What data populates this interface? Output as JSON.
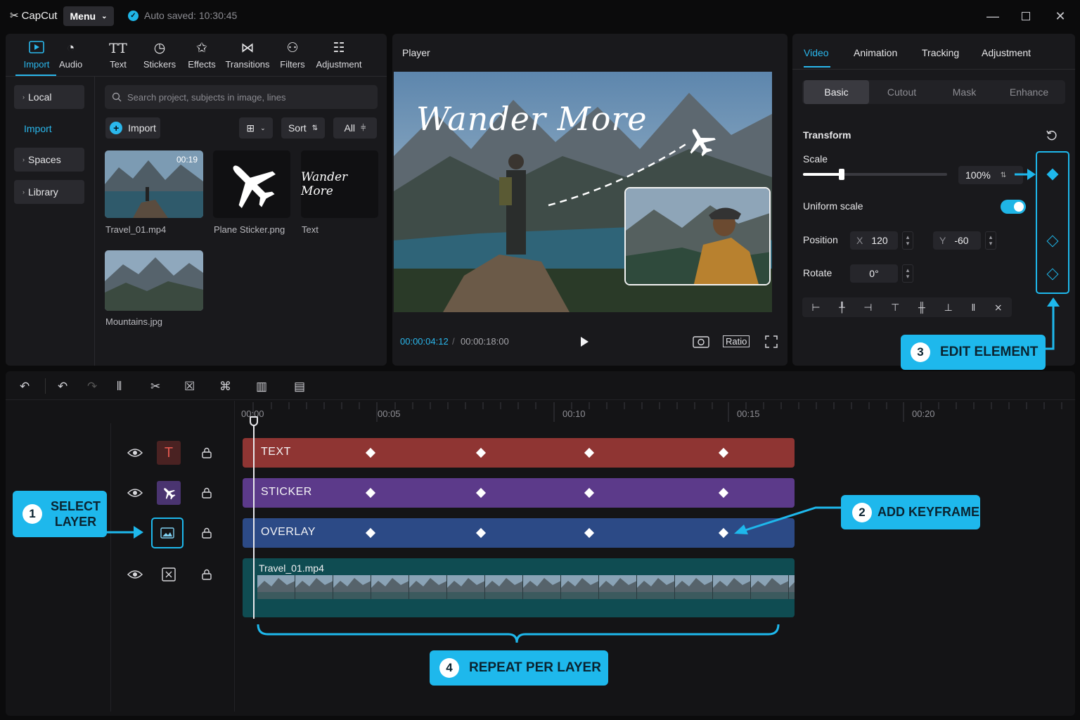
{
  "app": {
    "name": "CapCut",
    "menu_label": "Menu",
    "autosave": "Auto saved: 10:30:45"
  },
  "media": {
    "tools": [
      {
        "label": "Import",
        "icon": "import-icon",
        "active": true
      },
      {
        "label": "Audio",
        "icon": "audio-icon"
      },
      {
        "label": "Text",
        "icon": "text-icon"
      },
      {
        "label": "Stickers",
        "icon": "stickers-icon"
      },
      {
        "label": "Effects",
        "icon": "effects-icon"
      },
      {
        "label": "Transitions",
        "icon": "transitions-icon"
      },
      {
        "label": "Filters",
        "icon": "filters-icon"
      },
      {
        "label": "Adjustment",
        "icon": "adjustment-icon"
      }
    ],
    "sidebar": {
      "local": "Local",
      "import": "Import",
      "spaces": "Spaces",
      "library": "Library"
    },
    "search_placeholder": "Search project, subjects in image, lines",
    "import_button": "Import",
    "sort_label": "Sort",
    "all_label": "All",
    "items": [
      {
        "name": "Travel_01.mp4",
        "duration": "00:19"
      },
      {
        "name": "Plane Sticker.png"
      },
      {
        "name": "Text",
        "preview_text": "Wander More"
      },
      {
        "name": "Mountains.jpg"
      }
    ]
  },
  "player": {
    "title": "Player",
    "overlay_title": "Wander More",
    "current_time": "00:00:04:12",
    "total_time": "00:00:18:00",
    "ratio_label": "Ratio"
  },
  "props": {
    "tabs": [
      "Video",
      "Animation",
      "Tracking",
      "Adjustment"
    ],
    "subtabs": [
      "Basic",
      "Cutout",
      "Mask",
      "Enhance"
    ],
    "section_title": "Transform",
    "scale_label": "Scale",
    "scale_value": "100%",
    "scale_fraction": 0.27,
    "uniform_label": "Uniform scale",
    "uniform_on": true,
    "position_label": "Position",
    "pos_x_label": "X",
    "pos_x": "120",
    "pos_y_label": "Y",
    "pos_y": "-60",
    "rotate_label": "Rotate",
    "rotate_value": "0°"
  },
  "timeline": {
    "ruler": [
      "00:00",
      "00:05",
      "00:10",
      "00:15",
      "00:20"
    ],
    "tracks": [
      {
        "label": "TEXT",
        "color": "#8f3533"
      },
      {
        "label": "STICKER",
        "color": "#5c3a8a"
      },
      {
        "label": "OVERLAY",
        "color": "#2c4a86"
      }
    ],
    "video_clip": "Travel_01.mp4"
  },
  "callouts": {
    "c1_num": "1",
    "c1_line1": "SELECT",
    "c1_line2": "LAYER",
    "c2_num": "2",
    "c2_text": "ADD KEYFRAME",
    "c3_num": "3",
    "c3_text": "EDIT ELEMENT",
    "c4_num": "4",
    "c4_text": "REPEAT PER LAYER"
  },
  "colors": {
    "accent": "#2ab7ec",
    "callout": "#1eb8ec"
  }
}
